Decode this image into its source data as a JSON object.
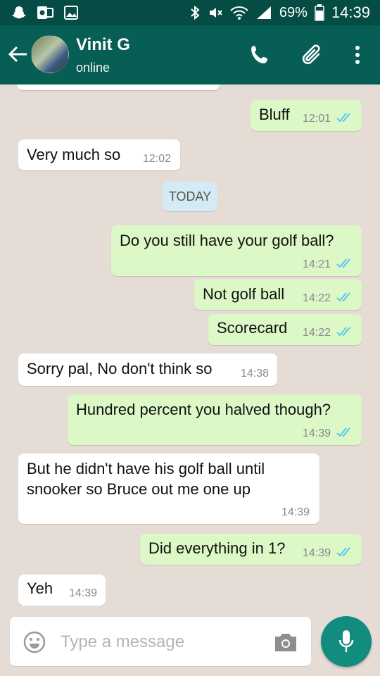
{
  "status_bar": {
    "battery_percent": "69%",
    "time": "14:39"
  },
  "header": {
    "contact_name": "Vinit G",
    "contact_status": "online"
  },
  "day_divider": "TODAY",
  "messages": [
    {
      "text": "Bluff",
      "time": "12:01"
    },
    {
      "text": "Very much so",
      "time": "12:02"
    },
    {
      "text": "Do you still have your golf ball?",
      "time": "14:21"
    },
    {
      "text": "Not golf ball",
      "time": "14:22"
    },
    {
      "text": "Scorecard",
      "time": "14:22"
    },
    {
      "text": "Sorry pal, No don't think so",
      "time": "14:38"
    },
    {
      "text": "Hundred percent you halved though?",
      "time": "14:39"
    },
    {
      "line1": "But he didn't have his golf ball until",
      "line2": "snooker so Bruce out me one up",
      "time": "14:39"
    },
    {
      "text": "Did everything in 1?",
      "time": "14:39"
    },
    {
      "text": "Yeh",
      "time": "14:39"
    }
  ],
  "composer": {
    "placeholder": "Type a message"
  },
  "colors": {
    "header": "#075e54",
    "statusbar": "#054d44",
    "outgoing_bubble": "#dcf8c6",
    "incoming_bubble": "#ffffff",
    "read_ticks": "#4fc3f7",
    "mic_button": "#128c7e"
  }
}
